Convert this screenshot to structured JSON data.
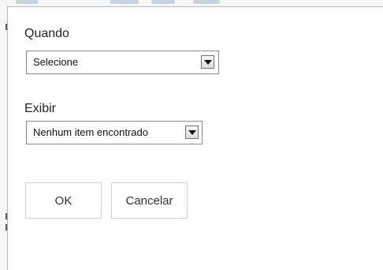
{
  "quando": {
    "label": "Quando",
    "selected": "Selecione"
  },
  "exibir": {
    "label": "Exibir",
    "selected": "Nenhum item encontrado"
  },
  "buttons": {
    "ok": "OK",
    "cancel": "Cancelar"
  },
  "icons": {
    "dropdown": "chevron-down-icon"
  }
}
